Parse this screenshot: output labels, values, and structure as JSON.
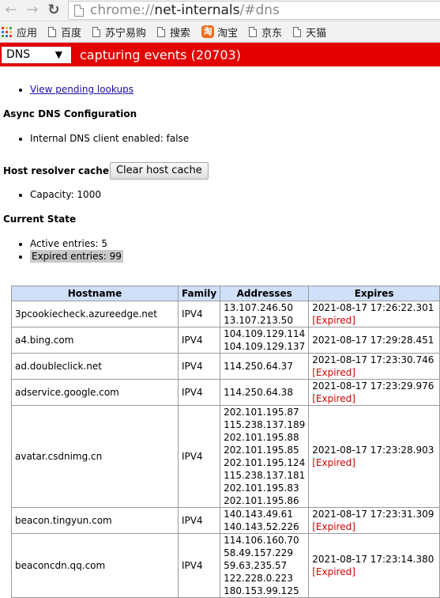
{
  "toolbar": {
    "url_scheme": "chrome://",
    "url_host": "net-internals",
    "url_path": "/#dns"
  },
  "bookmarks": [
    {
      "icon": "apps-grid-icon",
      "label": "应用"
    },
    {
      "icon": "page-icon",
      "label": "百度"
    },
    {
      "icon": "page-icon",
      "label": "苏宁易购"
    },
    {
      "icon": "page-icon",
      "label": "搜索"
    },
    {
      "icon": "taobao-icon",
      "label": "淘宝"
    },
    {
      "icon": "page-icon",
      "label": "京东"
    },
    {
      "icon": "page-icon",
      "label": "天猫"
    }
  ],
  "header": {
    "section_selected": "DNS",
    "status": "capturing events (20703)"
  },
  "colors": {
    "status_bar": "#e50000",
    "table_header": "#cfe0f8",
    "expired": "#d60000",
    "link": "#1a0dab"
  },
  "main": {
    "pending_link": "View pending lookups",
    "async_heading": "Async DNS Configuration",
    "internal_client": "Internal DNS client enabled: false",
    "resolver_heading": "Host resolver cache",
    "clear_button": "Clear host cache",
    "capacity": "Capacity: 1000",
    "state_heading": "Current State",
    "active_entries": "Active entries: 5",
    "expired_entries": "Expired entries: 99"
  },
  "table": {
    "columns": [
      "Hostname",
      "Family",
      "Addresses",
      "Expires"
    ],
    "rows": [
      {
        "hostname": "3pcookiecheck.azureedge.net",
        "family": "IPV4",
        "addresses": [
          "13.107.246.50",
          "13.107.213.50"
        ],
        "expires": "2021-08-17 17:26:22.301",
        "expired_label": "[Expired]"
      },
      {
        "hostname": "a4.bing.com",
        "family": "IPV4",
        "addresses": [
          "104.109.129.114",
          "104.109.129.137"
        ],
        "expires": "2021-08-17 17:29:28.451",
        "expired_label": ""
      },
      {
        "hostname": "ad.doubleclick.net",
        "family": "IPV4",
        "addresses": [
          "114.250.64.37"
        ],
        "expires": "2021-08-17 17:23:30.746",
        "expired_label": "[Expired]"
      },
      {
        "hostname": "adservice.google.com",
        "family": "IPV4",
        "addresses": [
          "114.250.64.38"
        ],
        "expires": "2021-08-17 17:23:29.976",
        "expired_label": "[Expired]"
      },
      {
        "hostname": "avatar.csdnimg.cn",
        "family": "IPV4",
        "addresses": [
          "202.101.195.87",
          "115.238.137.189",
          "202.101.195.88",
          "202.101.195.85",
          "202.101.195.124",
          "115.238.137.181",
          "202.101.195.83",
          "202.101.195.86"
        ],
        "expires": "2021-08-17 17:23:28.903",
        "expired_label": "[Expired]"
      },
      {
        "hostname": "beacon.tingyun.com",
        "family": "IPV4",
        "addresses": [
          "140.143.49.61",
          "140.143.52.226"
        ],
        "expires": "2021-08-17 17:23:31.309",
        "expired_label": "[Expired]"
      },
      {
        "hostname": "beaconcdn.qq.com",
        "family": "IPV4",
        "addresses": [
          "114.106.160.70",
          "58.49.157.229",
          "59.63.235.57",
          "122.228.0.223",
          "180.153.99.125"
        ],
        "expires": "2021-08-17 17:23:14.380",
        "expired_label": "[Expired]"
      }
    ]
  }
}
